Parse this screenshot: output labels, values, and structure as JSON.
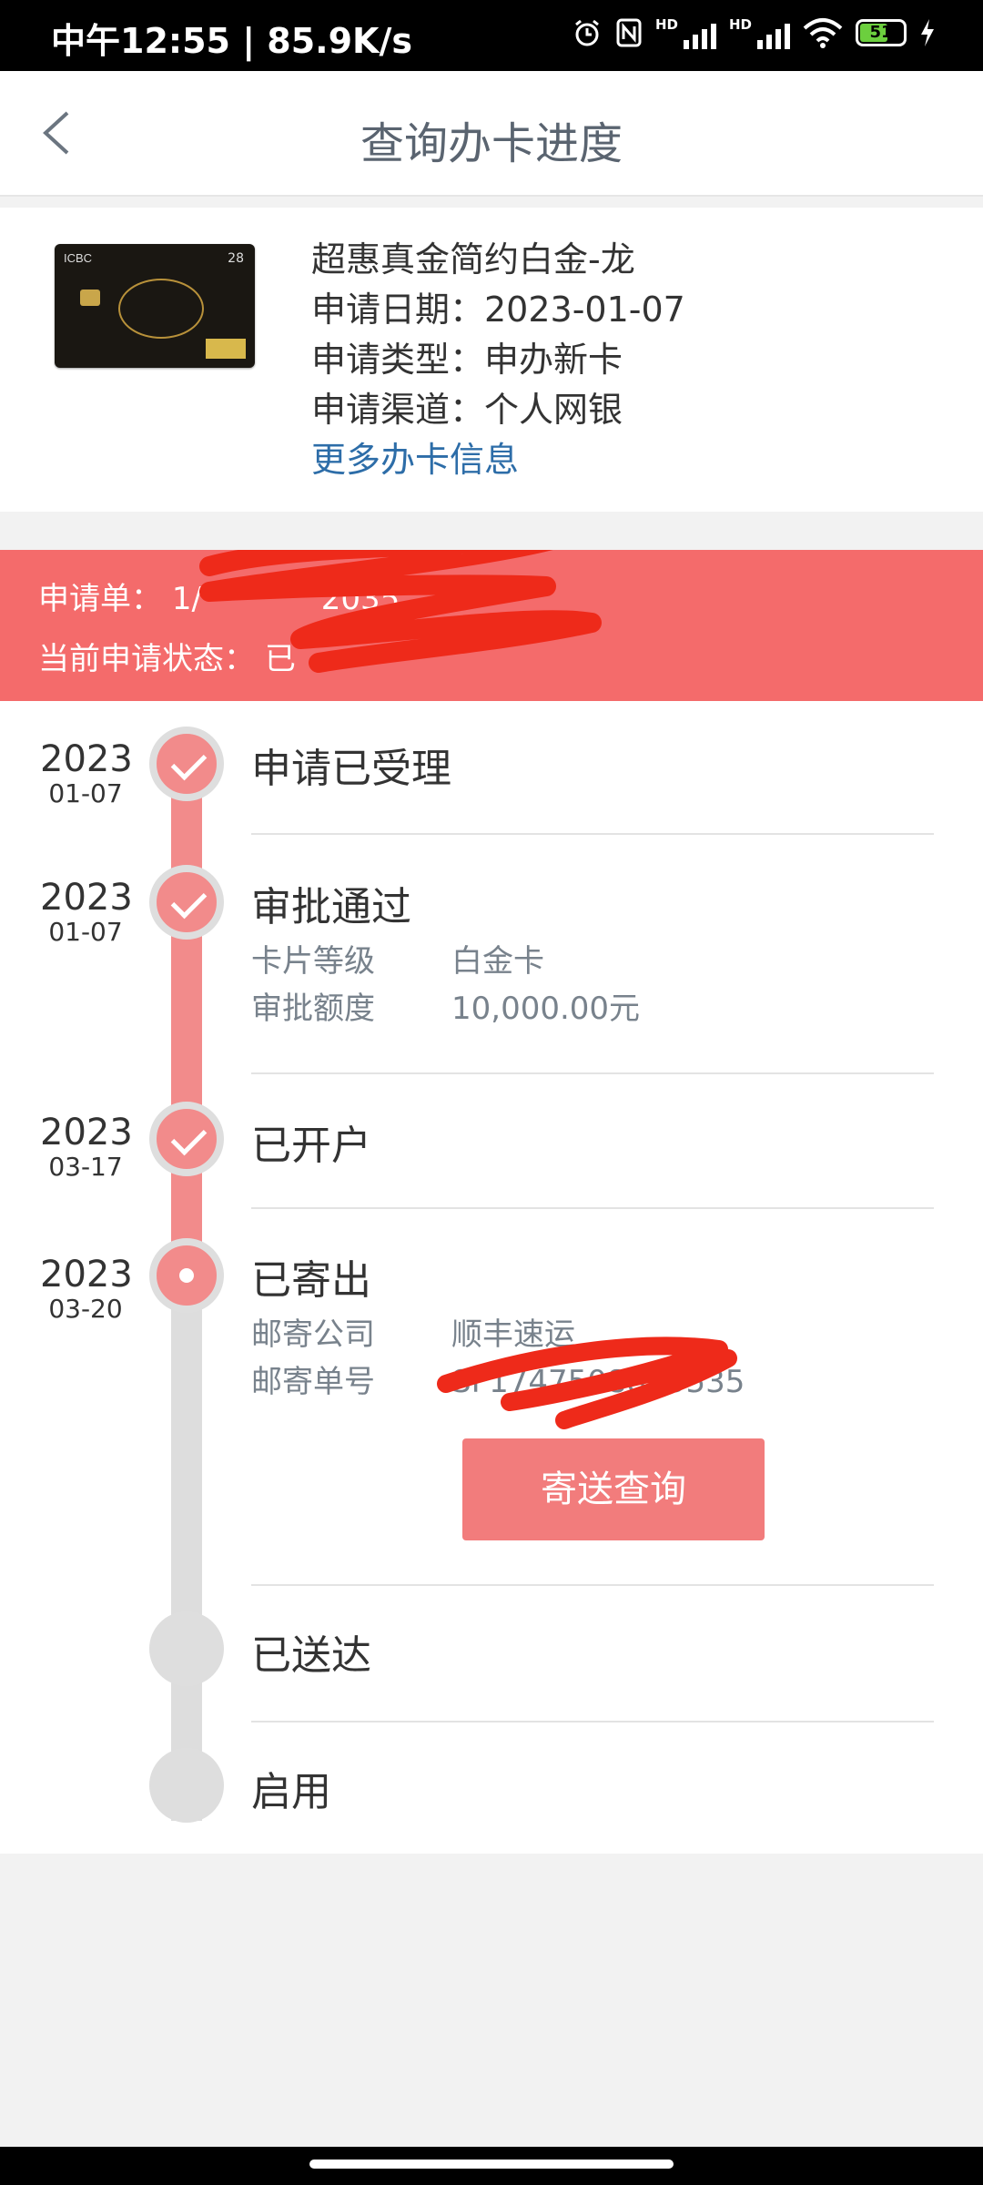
{
  "status_bar": {
    "time_speed": "中午12:55 | 85.9K/s",
    "sig1_label": "HD",
    "sig2_label": "HD",
    "battery": "51"
  },
  "nav": {
    "title": "查询办卡进度"
  },
  "card": {
    "name": "超惠真金简约白金-龙",
    "apply_date": "申请日期：2023-01-07",
    "apply_type": "申请类型：申办新卡",
    "apply_channel": "申请渠道：个人网银",
    "more_info": "更多办卡信息",
    "card_brand": "ICBC",
    "card_num": "28"
  },
  "banner": {
    "application_label": "申请单：",
    "application_no": "1/",
    "application_no_tail": "2035",
    "status_label": "当前申请状态：",
    "status_value": "已"
  },
  "timeline": {
    "steps": [
      {
        "year": "2023",
        "md": "01-07",
        "title": "申请已受理",
        "state": "done"
      },
      {
        "year": "2023",
        "md": "01-07",
        "title": "审批通过",
        "state": "done",
        "details": [
          {
            "k": "卡片等级",
            "v": "白金卡"
          },
          {
            "k": "审批额度",
            "v": "10,000.00元"
          }
        ]
      },
      {
        "year": "2023",
        "md": "03-17",
        "title": "已开户",
        "state": "done"
      },
      {
        "year": "2023",
        "md": "03-20",
        "title": "已寄出",
        "state": "current",
        "details": [
          {
            "k": "邮寄公司",
            "v": "顺丰速运"
          },
          {
            "k": "邮寄单号",
            "v": "SF1747508865535"
          }
        ]
      },
      {
        "title": "已送达",
        "state": "pending"
      },
      {
        "title": "启用",
        "state": "pending"
      }
    ],
    "track_button": "寄送查询"
  },
  "colors": {
    "accent": "#f46b6b",
    "progress": "#f28b8b",
    "link": "#2d6da8",
    "redaction": "#ee2a1a"
  }
}
